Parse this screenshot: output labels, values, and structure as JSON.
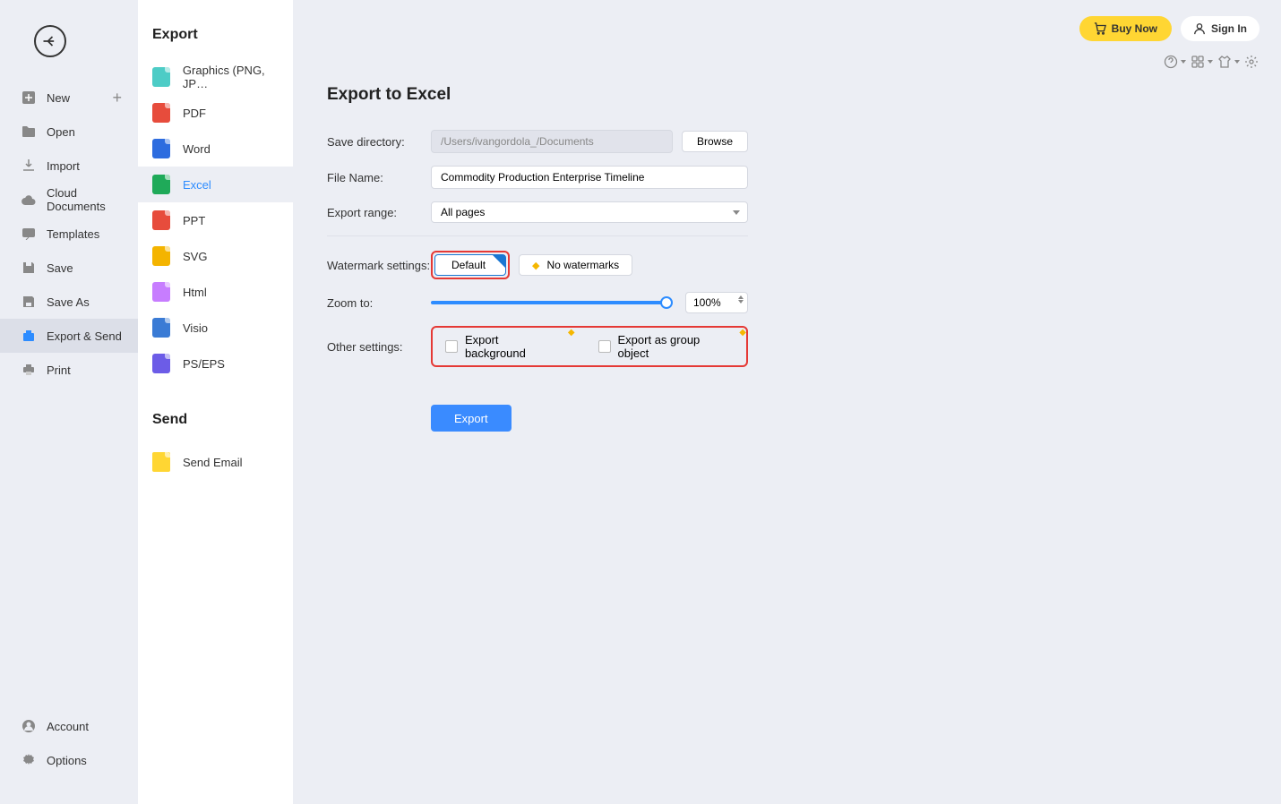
{
  "nav": {
    "items": [
      {
        "label": "New",
        "icon": "plus-square",
        "hasPlus": true
      },
      {
        "label": "Open",
        "icon": "folder"
      },
      {
        "label": "Import",
        "icon": "download"
      },
      {
        "label": "Cloud Documents",
        "icon": "cloud"
      },
      {
        "label": "Templates",
        "icon": "chat"
      },
      {
        "label": "Save",
        "icon": "save"
      },
      {
        "label": "Save As",
        "icon": "save-as"
      },
      {
        "label": "Export & Send",
        "icon": "box"
      },
      {
        "label": "Print",
        "icon": "printer"
      }
    ],
    "bottom": [
      {
        "label": "Account",
        "icon": "user-circle"
      },
      {
        "label": "Options",
        "icon": "gear"
      }
    ]
  },
  "export": {
    "title": "Export",
    "formats": [
      {
        "label": "Graphics (PNG, JP…",
        "color": "#4dccc6"
      },
      {
        "label": "PDF",
        "color": "#e74c3c"
      },
      {
        "label": "Word",
        "color": "#2d6cdf"
      },
      {
        "label": "Excel",
        "color": "#1faa59"
      },
      {
        "label": "PPT",
        "color": "#e74c3c"
      },
      {
        "label": "SVG",
        "color": "#f4b400"
      },
      {
        "label": "Html",
        "color": "#c77dff"
      },
      {
        "label": "Visio",
        "color": "#3a7bd5"
      },
      {
        "label": "PS/EPS",
        "color": "#6c5ce7"
      }
    ]
  },
  "send": {
    "title": "Send",
    "items": [
      {
        "label": "Send Email",
        "color": "#ffd633"
      }
    ]
  },
  "topbar": {
    "buy": "Buy Now",
    "signin": "Sign In"
  },
  "form": {
    "title": "Export to Excel",
    "saveDirLabel": "Save directory:",
    "saveDirValue": "/Users/ivangordola_/Documents",
    "browseLabel": "Browse",
    "fileNameLabel": "File Name:",
    "fileNameValue": "Commodity Production Enterprise Timeline",
    "rangeLabel": "Export range:",
    "rangeValue": "All pages",
    "watermarkLabel": "Watermark settings:",
    "wmDefault": "Default",
    "wmNone": "No watermarks",
    "zoomLabel": "Zoom to:",
    "zoomValue": "100%",
    "otherLabel": "Other settings:",
    "otherBg": "Export background",
    "otherGroup": "Export as group object",
    "exportBtn": "Export"
  }
}
